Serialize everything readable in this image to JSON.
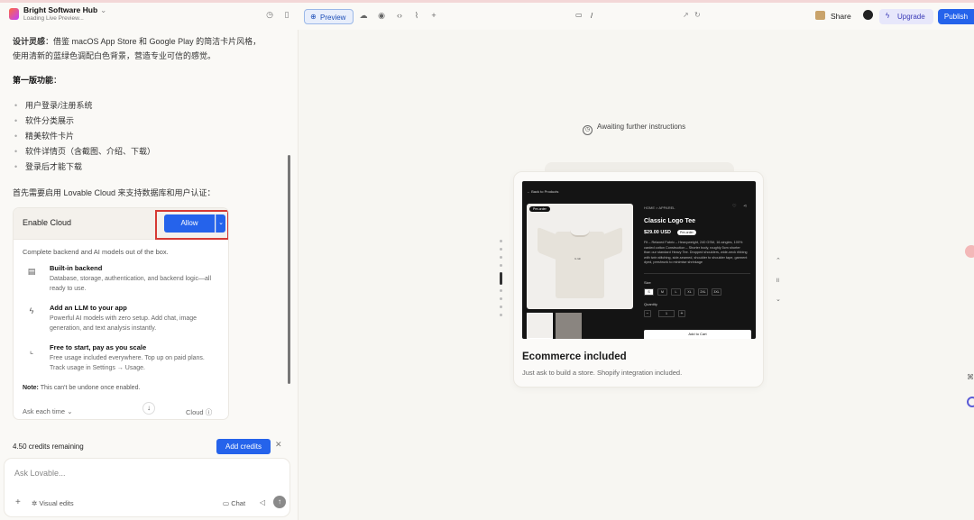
{
  "header": {
    "project_name": "Bright Software Hub",
    "status": "Loading Live Preview...",
    "chevron": "⌄"
  },
  "chat": {
    "design_label": "设计灵感",
    "design_text_1": "：借鉴 macOS App Store 和 Google Play 的简洁卡片风格，",
    "design_text_2": "使用清新的蓝绿色调配白色背景，营造专业可信的感觉。",
    "section_title": "第一版功能",
    "section_colon": "：",
    "features": [
      "用户登录/注册系统",
      "软件分类展示",
      "精美软件卡片",
      "软件详情页（含截图、介绍、下载）",
      "登录后才能下载"
    ],
    "intro": "首先需要启用 Lovable Cloud 来支持数据库和用户认证："
  },
  "cloud_card": {
    "title": "Enable Cloud",
    "allow_label": "Allow",
    "description": "Complete backend and AI models out of the box.",
    "items": [
      {
        "title": "Built-in backend",
        "desc": "Database, storage, authentication, and backend logic—all ready to use."
      },
      {
        "title": "Add an LLM to your app",
        "desc": "Powerful AI models with zero setup. Add chat, image generation, and text analysis instantly."
      },
      {
        "title": "Free to start, pay as you scale",
        "desc": "Free usage included everywhere. Top up on paid plans. Track usage in Settings → Usage."
      }
    ],
    "note_label": "Note:",
    "note_text": " This can't be undone once enabled.",
    "ask_label": "Ask each time",
    "cloud_label": "Cloud"
  },
  "credits": {
    "text": "4.50 credits remaining",
    "add_label": "Add credits"
  },
  "composer": {
    "placeholder": "Ask Lovable...",
    "visual_edits": "Visual edits",
    "chat": "Chat"
  },
  "toolbar": {
    "preview_label": "Preview",
    "url_path": "/",
    "share_label": "Share",
    "upgrade_label": "Upgrade",
    "publish_label": "Publish"
  },
  "preview": {
    "status": "Awaiting further instructions",
    "card_title": "Ecommerce included",
    "card_desc": "Just ask to build a store. Shopify integration included."
  },
  "shop_mock": {
    "back": "← Back to Products",
    "breadcrumb": "HOME > APPAREL",
    "preorder": "Pre-order",
    "product_title": "Classic Logo Tee",
    "price": "$29.00 USD",
    "price_badge": "Pre-order",
    "description": "Fit – Relaxed Fabric – Heavyweight, 240 GSM, 16-singles, 100% carded cotton Construction – Shorter body, roughly 5cm shorter than our standard Heavy Tee. Dropped shoulders, wide-neck ribbing with twin stitching, side-seamed, shoulder to shoulder tape, garment dyed, preshrunk to minimise shrinkage",
    "size_label": "Size",
    "sizes": [
      "S",
      "M",
      "L",
      "XL",
      "2XL",
      "3XL"
    ],
    "quantity_label": "Quantity",
    "qty_value": "1",
    "add_to_cart": "Add to Cart",
    "shirt_text": "G.lab"
  },
  "colors": {
    "accent": "#2563eb",
    "highlight_frame": "#d63a34"
  }
}
